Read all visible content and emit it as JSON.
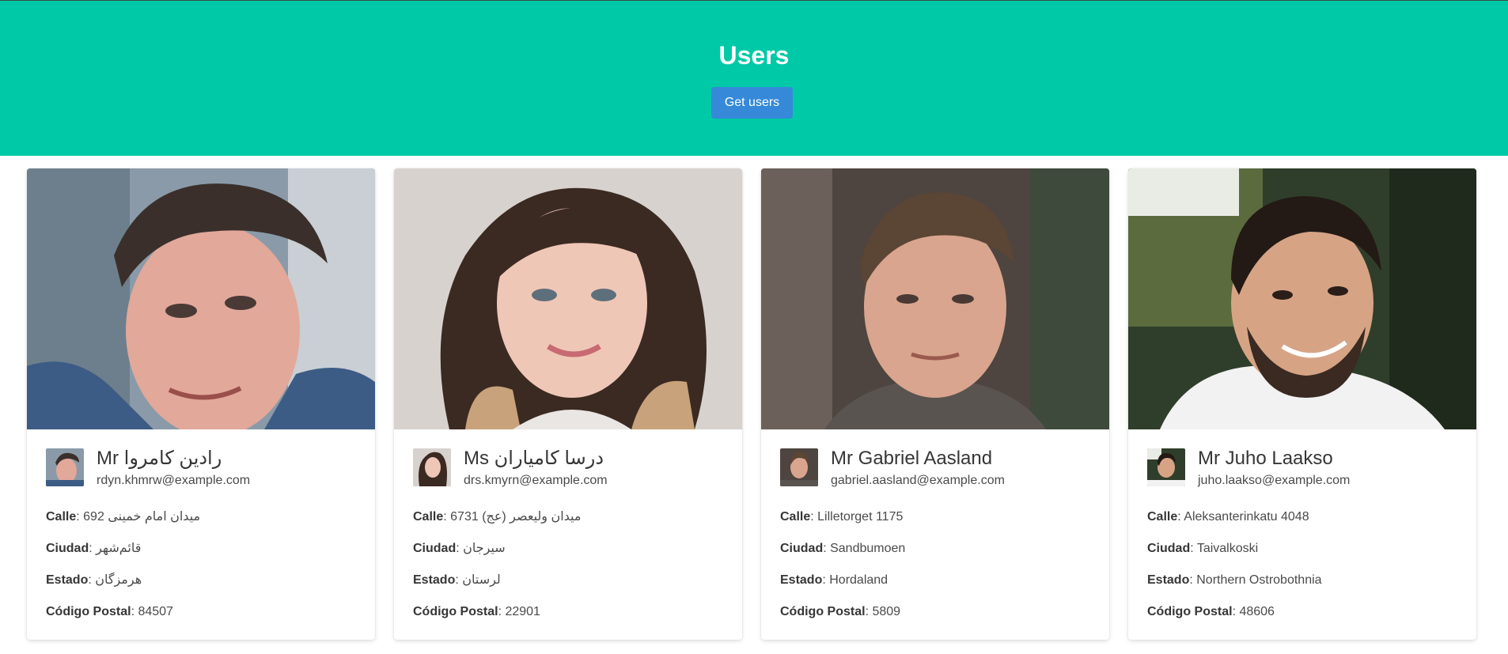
{
  "header": {
    "title": "Users",
    "get_users_label": "Get users"
  },
  "labels": {
    "street": "Calle",
    "city": "Ciudad",
    "state": "Estado",
    "postal_code": "Código Postal",
    "separator": ": "
  },
  "users": [
    {
      "name": "Mr رادین کامروا",
      "email": "rdyn.khmrw@example.com",
      "street": "692 میدان امام خمینی",
      "city": "قائم‌شهر",
      "state": "هرمزگان",
      "postal_code": "84507"
    },
    {
      "name": "Ms درسا کامیاران",
      "email": "drs.kmyrn@example.com",
      "street": "6731 میدان ولیعصر (عج)",
      "city": "سیرجان",
      "state": "لرستان",
      "postal_code": "22901"
    },
    {
      "name": "Mr Gabriel Aasland",
      "email": "gabriel.aasland@example.com",
      "street": "Lilletorget 1175",
      "city": "Sandbumoen",
      "state": "Hordaland",
      "postal_code": "5809"
    },
    {
      "name": "Mr Juho Laakso",
      "email": "juho.laakso@example.com",
      "street": "Aleksanterinkatu 4048",
      "city": "Taivalkoski",
      "state": "Northern Ostrobothnia",
      "postal_code": "48606"
    }
  ],
  "colors": {
    "hero_bg": "#00c9a7",
    "button_bg": "#3589d8"
  }
}
